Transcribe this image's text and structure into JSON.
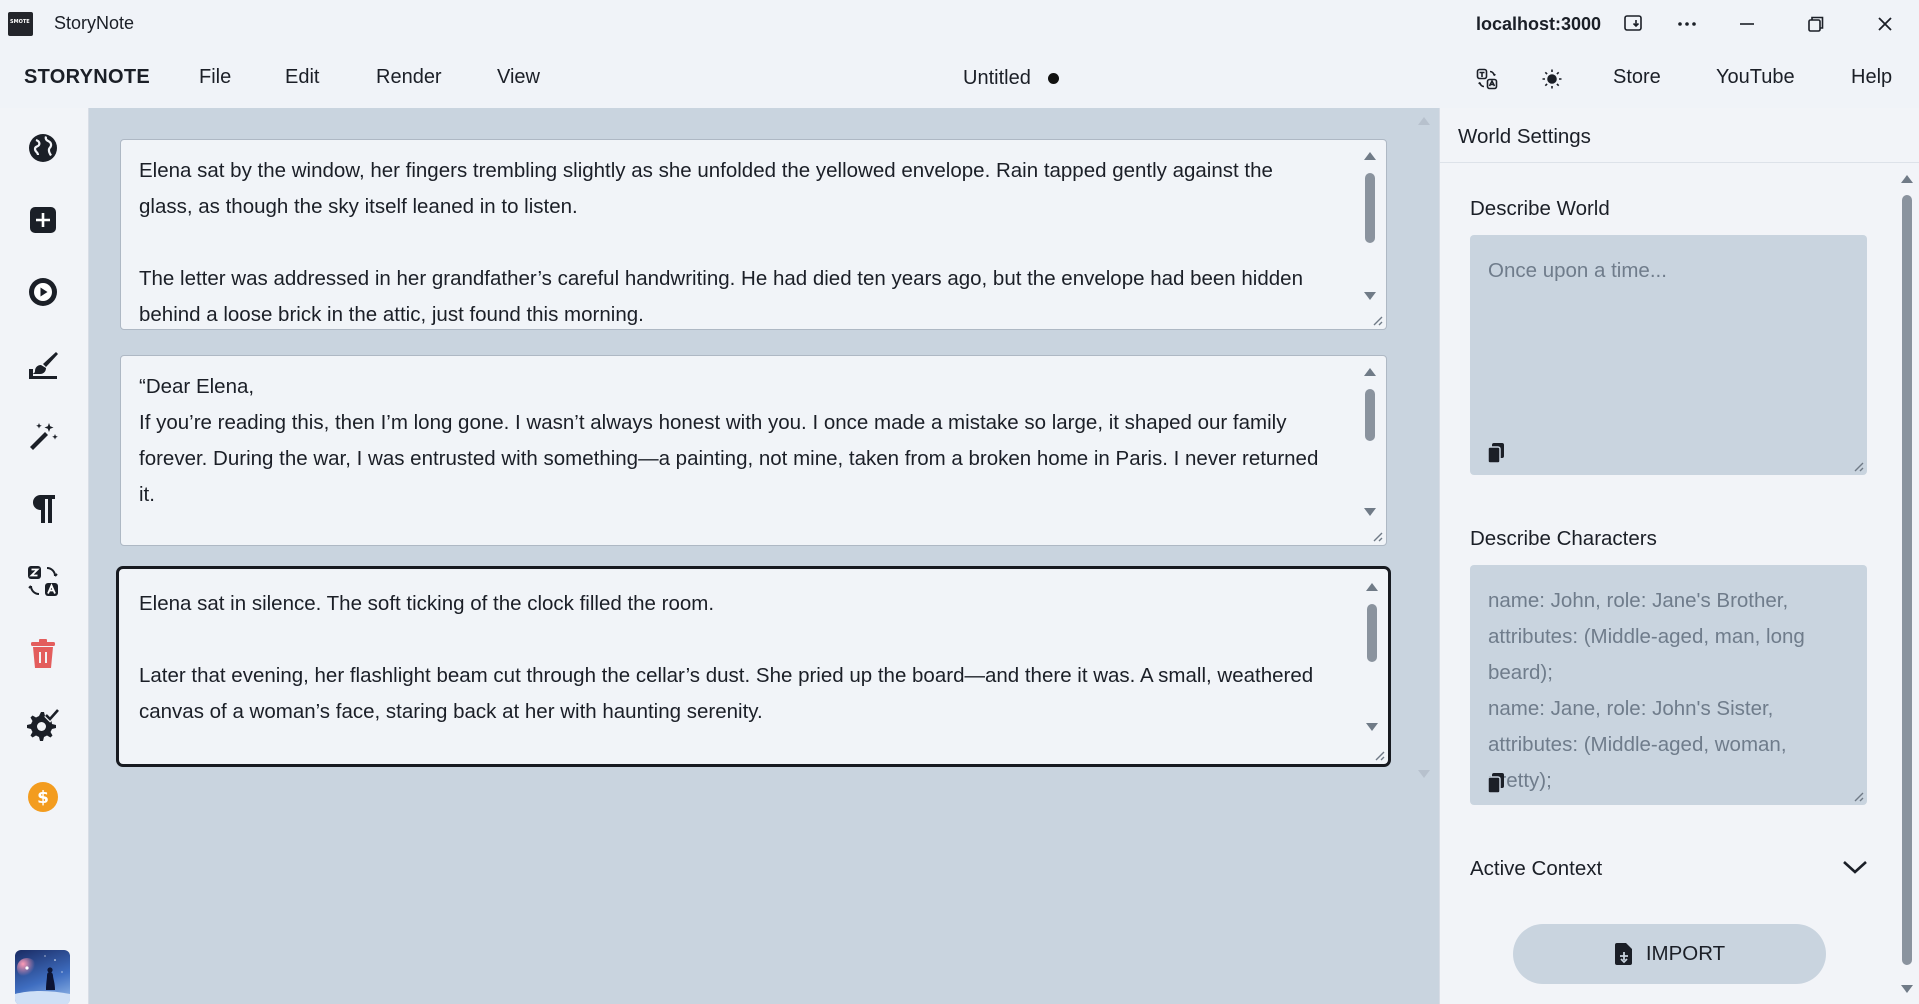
{
  "window": {
    "app_title": "StoryNote",
    "logo_text": "SMOTE",
    "host": "localhost:3000"
  },
  "menubar": {
    "brand": "STORYNOTE",
    "menus": [
      "File",
      "Edit",
      "Render",
      "View"
    ],
    "doc_title": "Untitled",
    "right_items": [
      "Store",
      "YouTube",
      "Help"
    ]
  },
  "sidebar": {
    "icons": [
      "globe-icon",
      "plus-square-icon",
      "play-circle-icon",
      "brush-icon",
      "magic-wand-icon",
      "paragraph-icon",
      "translate-icon",
      "trash-icon",
      "gear-check-icon",
      "dollar-coin-icon"
    ],
    "colors": {
      "trash": "#e35d5d",
      "coin": "#f39c1f"
    }
  },
  "scenes": [
    {
      "paragraphs": [
        "Elena sat by the window, her fingers trembling slightly as she unfolded the yellowed envelope. Rain tapped gently against the glass, as though the sky itself leaned in to listen.",
        "The letter was addressed in her grandfather’s careful handwriting. He had died ten years ago, but the envelope had been hidden behind a loose brick in the attic, just found this morning."
      ],
      "active": false
    },
    {
      "paragraphs": [
        "“Dear Elena,",
        "If you’re reading this, then I’m long gone. I wasn’t always honest with you. I once made a mistake so large, it shaped our family forever. During the war, I was entrusted with something—a painting, not mine, taken from a broken home in Paris. I never returned it."
      ],
      "active": false
    },
    {
      "paragraphs": [
        "Elena sat in silence. The soft ticking of the clock filled the room.",
        "Later that evening, her flashlight beam cut through the cellar’s dust. She pried up the board—and there it was. A small, weathered canvas of a woman’s face, staring back at her with haunting serenity."
      ],
      "active": true
    }
  ],
  "panel": {
    "title": "World Settings",
    "world_label": "Describe World",
    "world_placeholder": "Once upon a time...",
    "characters_label": "Describe Characters",
    "characters_placeholder": "name: John, role: Jane's Brother, attributes: (Middle-aged, man, long beard); name: Jane, role: John's Sister, attributes: (Middle-aged, woman, pretty);",
    "characters_lines": [
      "name: John, role: Jane's Brother,",
      "attributes: (Middle-aged, man, long",
      "beard);",
      "name: Jane, role: John's Sister,",
      "attributes: (Middle-aged, woman,",
      "pretty);"
    ],
    "active_context_label": "Active Context",
    "import_label": "IMPORT"
  }
}
